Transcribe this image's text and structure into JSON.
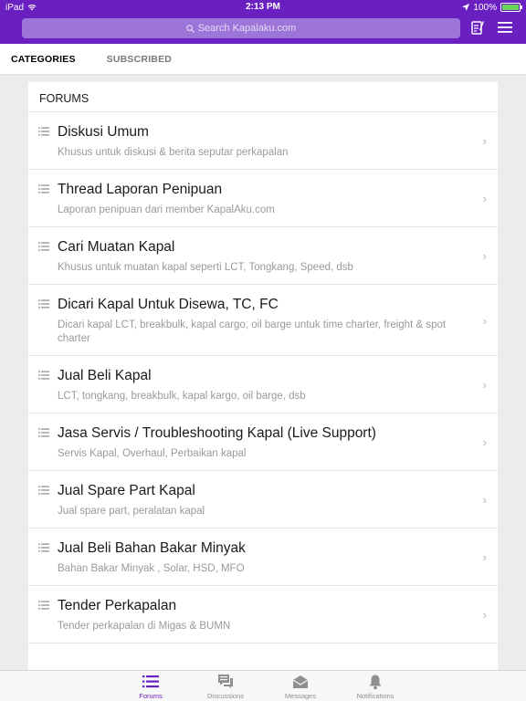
{
  "status": {
    "device": "iPad",
    "time": "2:13 PM",
    "battery": "100%",
    "battery_level": 1.0
  },
  "search": {
    "placeholder": "Search Kapalaku.com"
  },
  "tabs": [
    {
      "label": "CATEGORIES",
      "active": true
    },
    {
      "label": "SUBSCRIBED",
      "active": false
    }
  ],
  "forums": {
    "title": "FORUMS",
    "items": [
      {
        "title": "Diskusi Umum",
        "desc": "Khusus untuk diskusi & berita seputar perkapalan"
      },
      {
        "title": "Thread Laporan Penipuan",
        "desc": "Laporan penipuan dari member KapalAku.com"
      },
      {
        "title": "Cari Muatan Kapal",
        "desc": "Khusus  untuk muatan kapal seperti LCT, Tongkang, Speed, dsb"
      },
      {
        "title": "Dicari Kapal Untuk Disewa, TC, FC",
        "desc": "Dicari kapal LCT, breakbulk, kapal cargo, oil barge untuk time charter, freight & spot charter"
      },
      {
        "title": "Jual Beli Kapal",
        "desc": "LCT, tongkang, breakbulk, kapal kargo, oil barge, dsb"
      },
      {
        "title": "Jasa Servis / Troubleshooting Kapal (Live Support)",
        "desc": "Servis Kapal, Overhaul, Perbaikan kapal"
      },
      {
        "title": "Jual Spare Part Kapal",
        "desc": "Jual spare part, peralatan kapal"
      },
      {
        "title": "Jual Beli Bahan Bakar Minyak",
        "desc": "Bahan Bakar Minyak , Solar, HSD, MFO"
      },
      {
        "title": "Tender Perkapalan",
        "desc": "Tender perkapalan di Migas & BUMN"
      }
    ]
  },
  "tabbar": [
    {
      "label": "Forums",
      "icon": "forums-icon",
      "active": true
    },
    {
      "label": "Discussions",
      "icon": "discussions-icon",
      "active": false
    },
    {
      "label": "Messages",
      "icon": "messages-icon",
      "active": false
    },
    {
      "label": "Notifications",
      "icon": "notifications-icon",
      "active": false
    }
  ],
  "colors": {
    "brand": "#6a1fc1",
    "search_bg": "#9d75d8",
    "battery": "#6ad45b"
  }
}
